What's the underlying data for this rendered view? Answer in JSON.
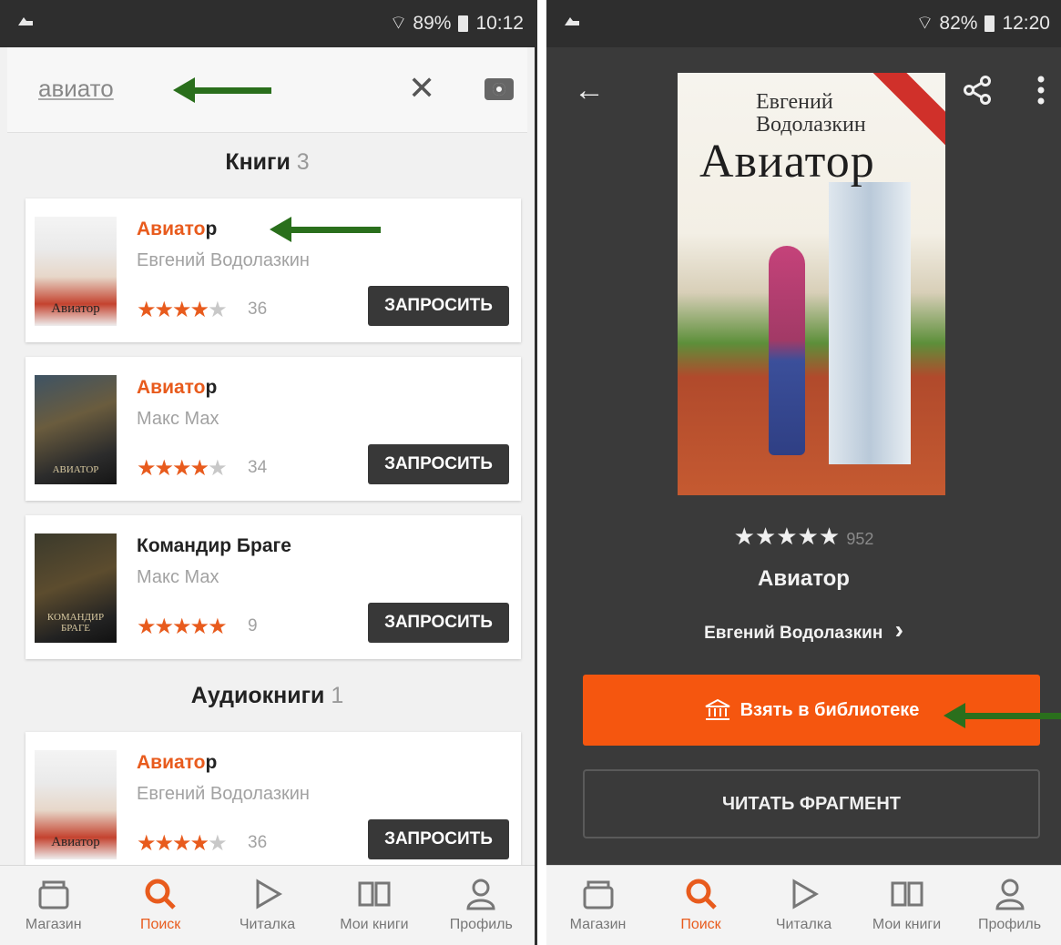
{
  "left": {
    "status": {
      "signal": "89%",
      "time": "10:12"
    },
    "search": {
      "value": "авиато"
    },
    "sections": {
      "books": {
        "title": "Книги",
        "count": "3"
      },
      "audio": {
        "title": "Аудиокниги",
        "count": "1"
      }
    },
    "results": [
      {
        "title_highlight": "Авиато",
        "title_rest": "р",
        "author": "Евгений Водолазкин",
        "stars": "★★★★",
        "stars_off": "★",
        "reviews": "36",
        "button": "ЗАПРОСИТЬ",
        "cover_text": "Авиатор"
      },
      {
        "title_highlight": "Авиато",
        "title_rest": "р",
        "author": "Макс Мах",
        "stars": "★★★★",
        "stars_off": "★",
        "reviews": "34",
        "button": "ЗАПРОСИТЬ",
        "cover_text": "АВИАТОР"
      },
      {
        "title_highlight": "",
        "title_rest": "Командир Браге",
        "author": "Макс Мах",
        "stars": "★★★★★",
        "stars_off": "",
        "reviews": "9",
        "button": "ЗАПРОСИТЬ",
        "cover_text": "КОМАНДИР БРАГЕ"
      },
      {
        "title_highlight": "Авиато",
        "title_rest": "р",
        "author": "Евгений Водолазкин",
        "stars": "★★★★",
        "stars_off": "★",
        "reviews": "36",
        "button": "ЗАПРОСИТЬ",
        "cover_text": "Авиатор"
      }
    ]
  },
  "right": {
    "status": {
      "signal": "82%",
      "time": "12:20"
    },
    "cover": {
      "author": "Евгений Водолазкин",
      "title": "Авиатор"
    },
    "rating": {
      "stars": "★★★★★",
      "count": "952"
    },
    "book_title": "Авиатор",
    "author_link": "Евгений Водолазкин",
    "take_button": "Взять в библиотеке",
    "read_button": "ЧИТАТЬ ФРАГМЕНТ"
  },
  "nav": {
    "items": [
      {
        "label": "Магазин",
        "icon": "store-icon"
      },
      {
        "label": "Поиск",
        "icon": "search-icon"
      },
      {
        "label": "Читалка",
        "icon": "play-icon"
      },
      {
        "label": "Мои книги",
        "icon": "book-icon"
      },
      {
        "label": "Профиль",
        "icon": "profile-icon"
      }
    ],
    "active_color": "#e85b1d"
  },
  "colors": {
    "accent": "#f5560f",
    "arrow": "#2a6f1c",
    "dark_button": "#383838"
  }
}
